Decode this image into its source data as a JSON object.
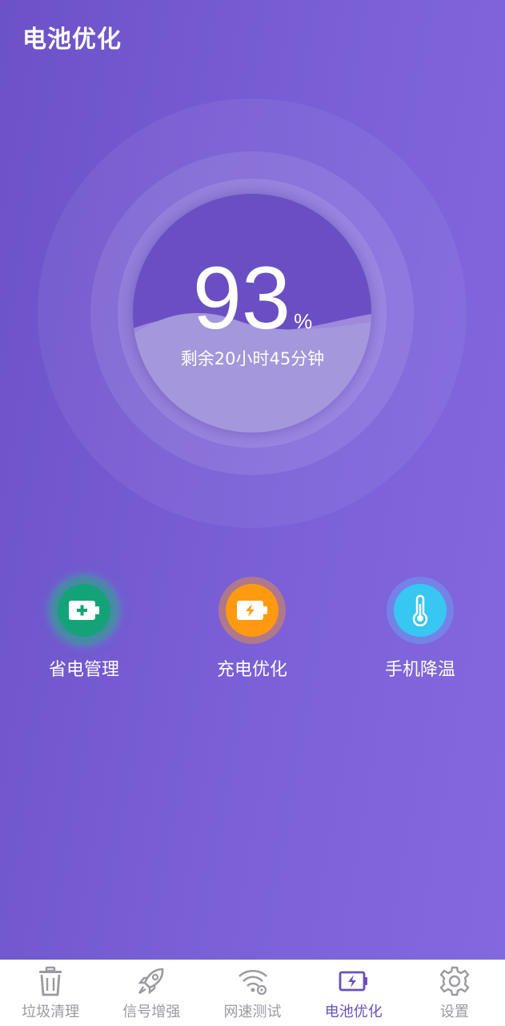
{
  "header": {
    "title": "电池优化"
  },
  "battery": {
    "level": 93,
    "level_text": "93",
    "unit": "%",
    "remaining": "剩余20小时45分钟"
  },
  "features": [
    {
      "label": "省电管理",
      "icon": "battery-plus-icon",
      "color": "#14a378"
    },
    {
      "label": "充电优化",
      "icon": "battery-charge-icon",
      "color": "#ff9a10"
    },
    {
      "label": "手机降温",
      "icon": "thermometer-icon",
      "color": "#38c6f2"
    }
  ],
  "tabs": [
    {
      "label": "垃圾清理",
      "icon": "trash-icon",
      "active": false
    },
    {
      "label": "信号增强",
      "icon": "rocket-icon",
      "active": false
    },
    {
      "label": "网速测试",
      "icon": "wifi-speed-icon",
      "active": false
    },
    {
      "label": "电池优化",
      "icon": "battery-icon",
      "active": true
    },
    {
      "label": "设置",
      "icon": "gear-icon",
      "active": false
    }
  ],
  "colors": {
    "accent": "#6a4fc4",
    "inactive": "#9a9aa2"
  }
}
